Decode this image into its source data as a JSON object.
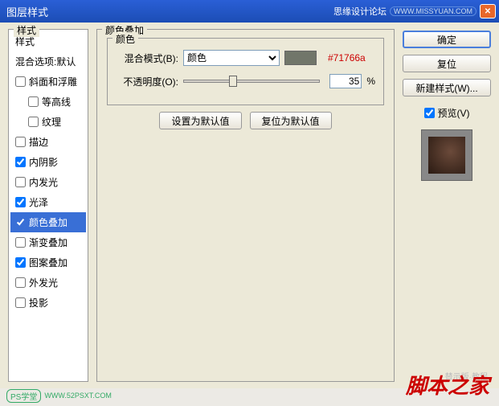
{
  "titlebar": {
    "title": "图层样式",
    "forum": "思缘设计论坛",
    "url": "WWW.MISSYUAN.COM"
  },
  "left": {
    "label": "样式",
    "items": [
      {
        "label": "样式",
        "checked": null,
        "header": true
      },
      {
        "label": "混合选项:默认",
        "checked": null
      },
      {
        "label": "斜面和浮雕",
        "checked": false
      },
      {
        "label": "等高线",
        "checked": false,
        "sub": true
      },
      {
        "label": "纹理",
        "checked": false,
        "sub": true
      },
      {
        "label": "描边",
        "checked": false
      },
      {
        "label": "内阴影",
        "checked": true
      },
      {
        "label": "内发光",
        "checked": false
      },
      {
        "label": "光泽",
        "checked": true
      },
      {
        "label": "颜色叠加",
        "checked": true,
        "selected": true
      },
      {
        "label": "渐变叠加",
        "checked": false
      },
      {
        "label": "图案叠加",
        "checked": true
      },
      {
        "label": "外发光",
        "checked": false
      },
      {
        "label": "投影",
        "checked": false
      }
    ]
  },
  "center": {
    "title": "颜色叠加",
    "group_label": "颜色",
    "blend_label": "混合模式(B):",
    "blend_value": "颜色",
    "hex": "#71766a",
    "opacity_label": "不透明度(O):",
    "opacity_value": "35",
    "opacity_unit": "%",
    "btn_default": "设置为默认值",
    "btn_reset": "复位为默认值"
  },
  "right": {
    "ok": "确定",
    "cancel": "复位",
    "newstyle": "新建样式(W)...",
    "preview": "预览(V)"
  },
  "footer": {
    "badge": "PS学堂",
    "url": "WWW.52PSXT.COM"
  },
  "watermark": "脚本之家",
  "watermark_sub": "替示版·教程"
}
